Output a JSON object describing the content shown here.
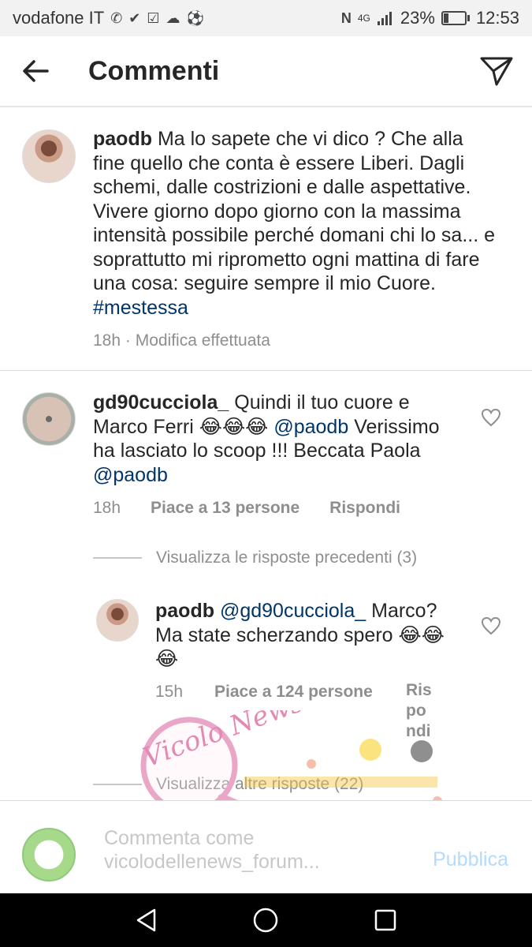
{
  "status_bar": {
    "carrier": "vodafone IT",
    "network": "4G",
    "battery": "23%",
    "battery_level": 0.23,
    "time": "12:53"
  },
  "header": {
    "title": "Commenti"
  },
  "caption": {
    "username": "paodb",
    "text": "Ma lo sapete che vi dico ? Che alla fine quello che conta è essere Liberi. Dagli schemi, dalle costrizioni e dalle aspettative. Vivere giorno dopo giorno con la massima intensità possibile perché domani chi lo sa... e soprattutto mi riprometto ogni mattina di fare una cosa: seguire sempre il mio Cuore.",
    "hashtag": "#mestessa",
    "meta": "18h · Modifica effettuata"
  },
  "comment1": {
    "username": "gd90cucciola_",
    "text_1": "Quindi il tuo cuore e Marco Ferri 😂😂😂",
    "mention_1": "@paodb",
    "text_2": "Verissimo ha lasciato lo scoop !!! Beccata Paola",
    "mention_2": "@paodb",
    "time": "18h",
    "likes": "Piace a 13 persone",
    "reply": "Rispondi",
    "view_previous": "Visualizza le risposte precedenti (3)"
  },
  "reply1": {
    "username": "paodb",
    "mention": "@gd90cucciola_",
    "text": "Marco? Ma state scherzando spero 😂😂😂",
    "time": "15h",
    "likes": "Piace a 124 persone",
    "reply_1": "Ris",
    "reply_2": "po",
    "reply_3": "ndi",
    "view_more": "Visualizza altre risposte (22)"
  },
  "watermark": {
    "text": "Vicolo News"
  },
  "input_bar": {
    "placeholder_line1": "Commenta come",
    "placeholder_line2": "vicolodellenews_forum...",
    "publish": "Pubblica"
  },
  "colors": {
    "link": "#003569",
    "meta": "#8e8e8e",
    "publish": "#b3dbff"
  }
}
